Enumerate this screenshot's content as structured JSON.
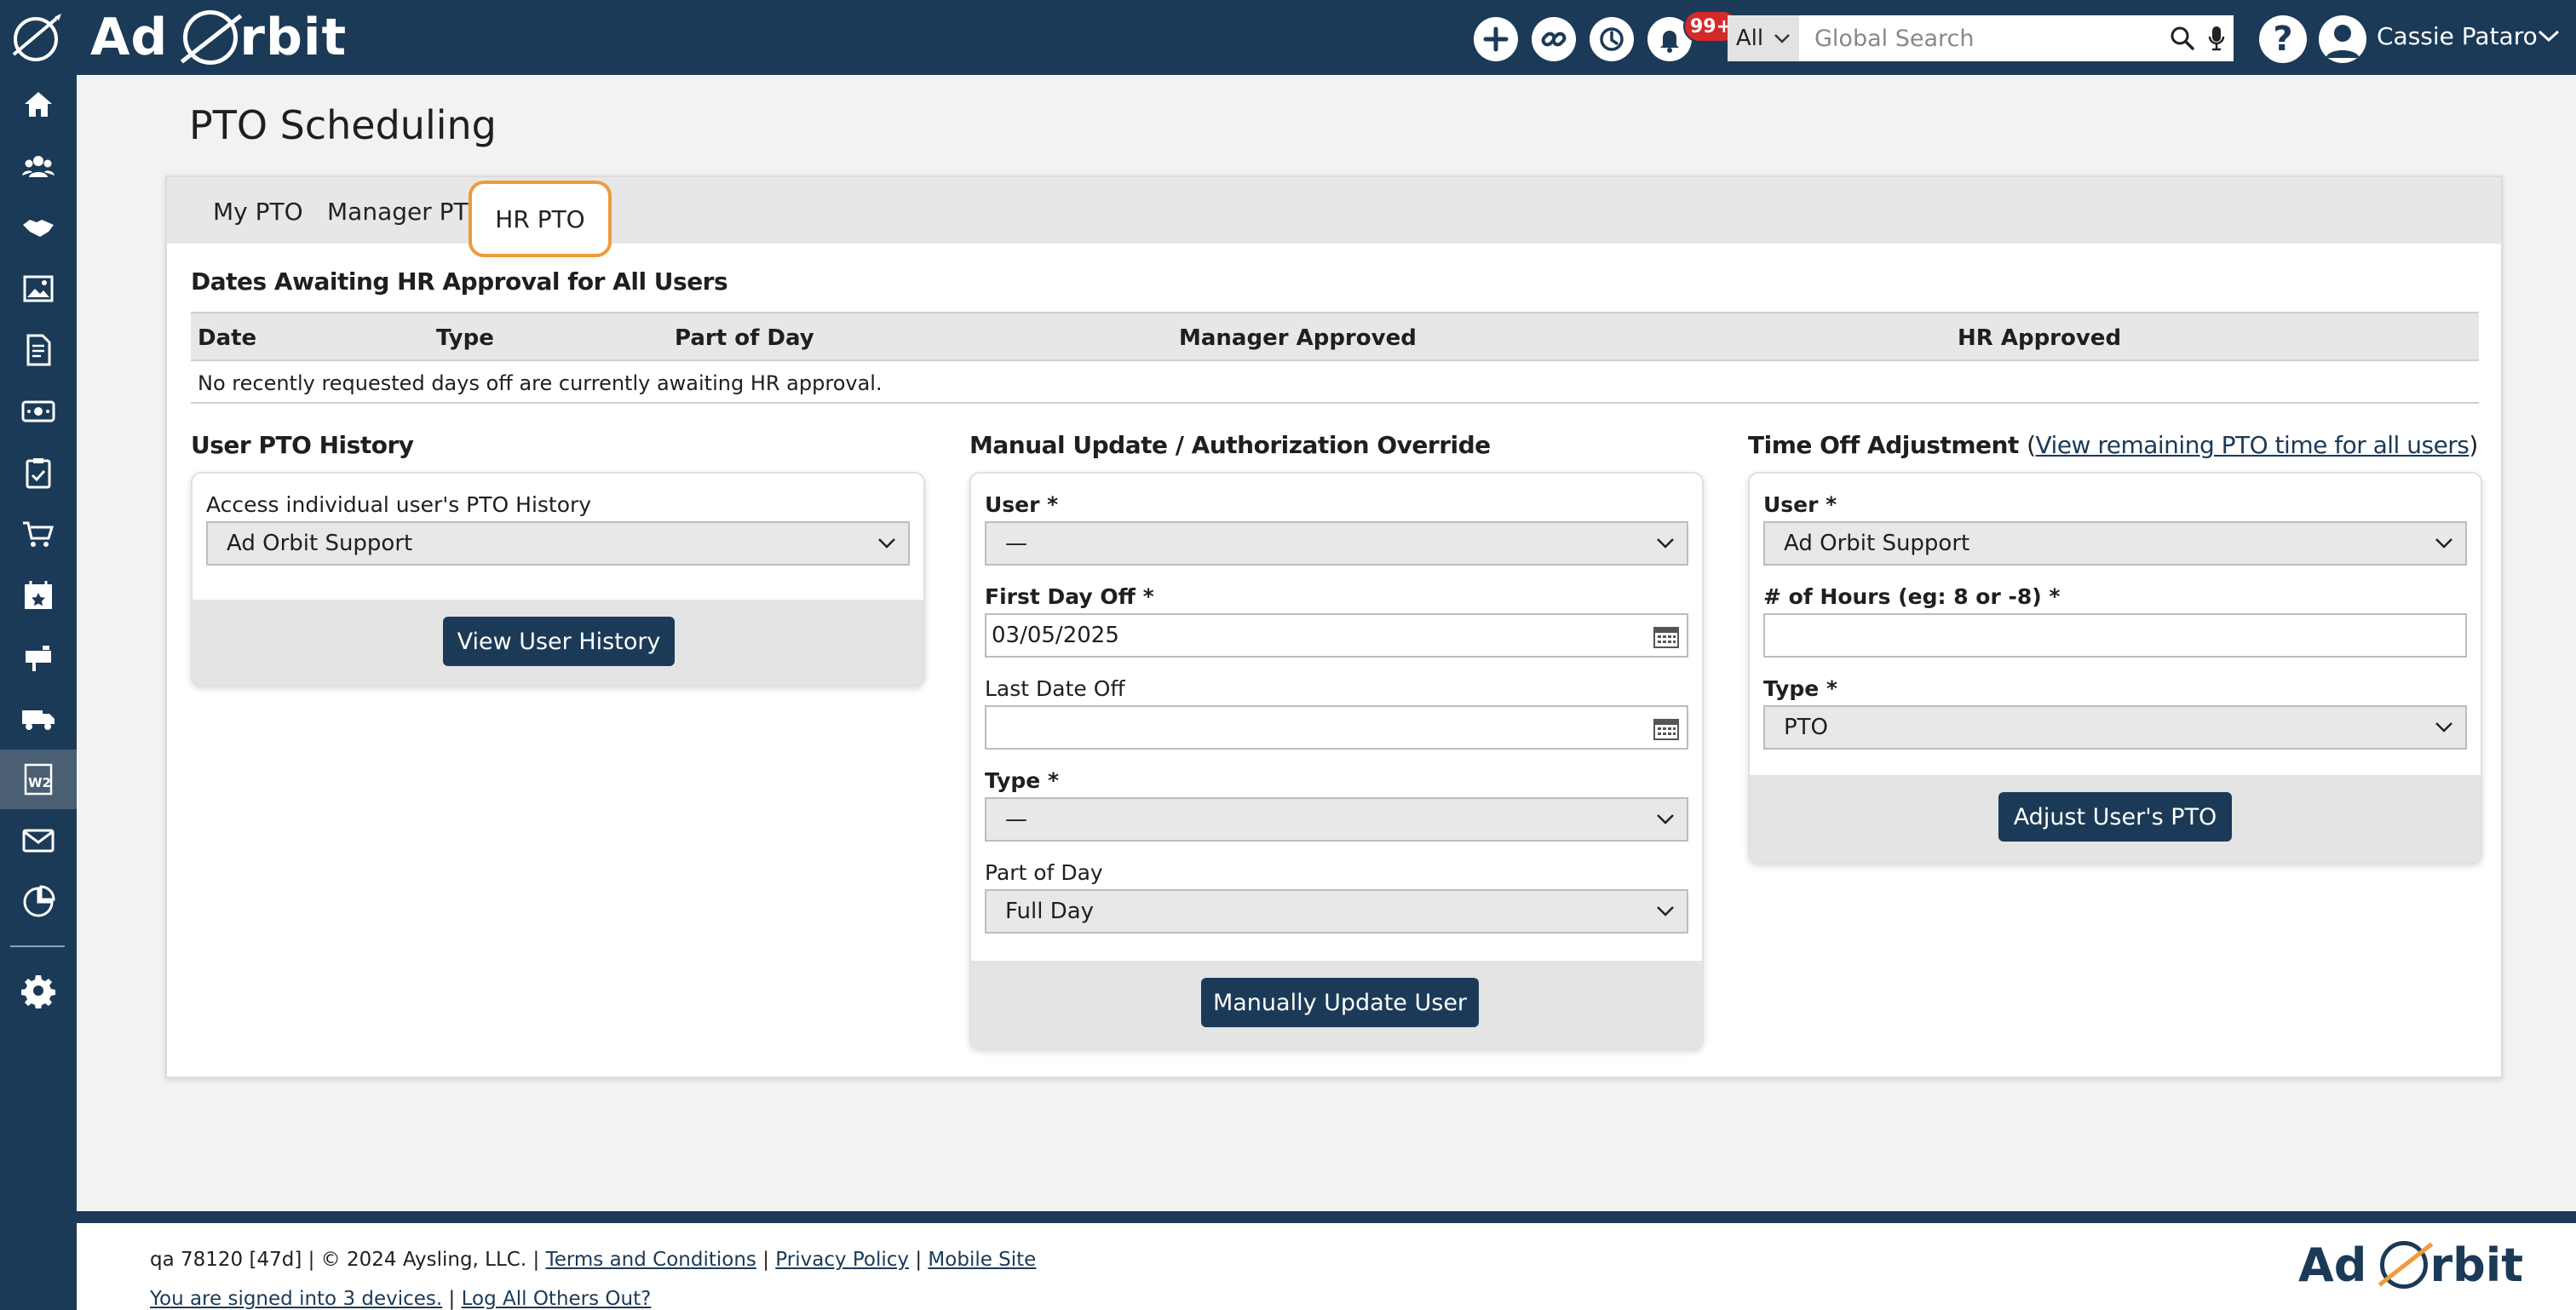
{
  "app": {
    "brand_left": "Ad",
    "brand_right": "rbit",
    "accent_color": "#1b3a57",
    "highlight_color": "#ef9b3c"
  },
  "topbar": {
    "notifications_badge": "99+",
    "search_scope": "All",
    "search_placeholder": "Global Search",
    "help_label": "?",
    "user_name": "Cassie Pataro",
    "icons": [
      "plus-icon",
      "link-icon",
      "history-icon",
      "bell-icon",
      "search-icon",
      "microphone-icon",
      "help-icon",
      "user-avatar-icon",
      "chevron-down-icon"
    ]
  },
  "sidebar": {
    "items": [
      "home-icon",
      "contacts-icon",
      "deals-icon",
      "media-icon",
      "orders-icon",
      "billing-icon",
      "tasks-icon",
      "cart-icon",
      "calendar-icon",
      "mailbox-icon",
      "delivery-icon",
      "w2-icon",
      "mail-icon",
      "reports-icon",
      "settings-icon"
    ],
    "active": "w2-icon"
  },
  "page": {
    "title": "PTO Scheduling",
    "tabs": [
      "My PTO",
      "Manager PTO",
      "HR PTO"
    ],
    "active_tab": "HR PTO"
  },
  "awaiting": {
    "title": "Dates Awaiting HR Approval for All Users",
    "columns": [
      "Date",
      "Type",
      "Part of Day",
      "Manager Approved",
      "HR Approved"
    ],
    "empty_message": "No recently requested days off are currently awaiting HR approval."
  },
  "history": {
    "title": "User PTO History",
    "label": "Access individual user's PTO History",
    "selected_user": "Ad Orbit Support",
    "button": "View User History"
  },
  "manual": {
    "title": "Manual Update / Authorization Override",
    "user_label": "User *",
    "user_value": "—",
    "first_day_label": "First Day Off *",
    "first_day_value": "03/05/2025",
    "last_day_label": "Last Date Off",
    "last_day_value": "",
    "type_label": "Type *",
    "type_value": "—",
    "part_label": "Part of Day",
    "part_value": "Full Day",
    "button": "Manually Update User"
  },
  "adjustment": {
    "title": "Time Off Adjustment",
    "link_open": "(",
    "link_text": "View remaining PTO time for all users",
    "link_close": ")",
    "user_label": "User *",
    "user_value": "Ad Orbit Support",
    "hours_label": "# of Hours (eg: 8 or -8) *",
    "hours_value": "",
    "type_label": "Type *",
    "type_value": "PTO",
    "button": "Adjust User's PTO"
  },
  "footer": {
    "build": "qa 78120 [47d] | © 2024 Aysling, LLC. |",
    "terms": "Terms and Conditions",
    "sep1": "|",
    "privacy": "Privacy Policy",
    "sep2": "|",
    "mobile": "Mobile Site",
    "signed_in": "You are signed into 3 devices.",
    "sep3": "|",
    "logout_others": "Log All Others Out?"
  }
}
